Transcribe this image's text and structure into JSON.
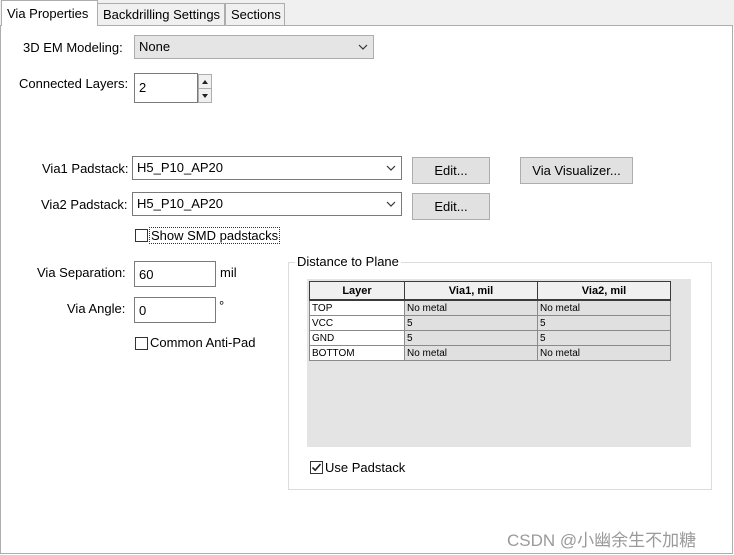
{
  "tabs": [
    {
      "label": "Via Properties",
      "active": true
    },
    {
      "label": "Backdrilling Settings",
      "active": false
    },
    {
      "label": "Sections",
      "active": false
    }
  ],
  "em_modeling": {
    "label": "3D EM Modeling:",
    "value": "None"
  },
  "connected_layers": {
    "label": "Connected Layers:",
    "value": "2"
  },
  "via1": {
    "label": "Via1 Padstack:",
    "value": "H5_P10_AP20",
    "edit_label": "Edit..."
  },
  "via2": {
    "label": "Via2 Padstack:",
    "value": "H5_P10_AP20",
    "edit_label": "Edit..."
  },
  "visualizer_label": "Via Visualizer...",
  "show_smd": {
    "label": "Show SMD padstacks",
    "checked": false
  },
  "via_separation": {
    "label": "Via Separation:",
    "value": "60",
    "unit": "mil"
  },
  "via_angle": {
    "label": "Via Angle:",
    "value": "0",
    "unit": "°"
  },
  "common_antipad": {
    "label": "Common Anti-Pad",
    "checked": false
  },
  "distance_group": {
    "title": "Distance to Plane",
    "columns": [
      "Layer",
      "Via1, mil",
      "Via2, mil"
    ],
    "rows": [
      [
        "TOP",
        "No metal",
        "No metal"
      ],
      [
        "VCC",
        "5",
        "5"
      ],
      [
        "GND",
        "5",
        "5"
      ],
      [
        "BOTTOM",
        "No metal",
        "No metal"
      ]
    ],
    "use_padstack": {
      "label": "Use Padstack",
      "checked": true
    }
  },
  "watermark": "CSDN @小幽余生不加糖"
}
